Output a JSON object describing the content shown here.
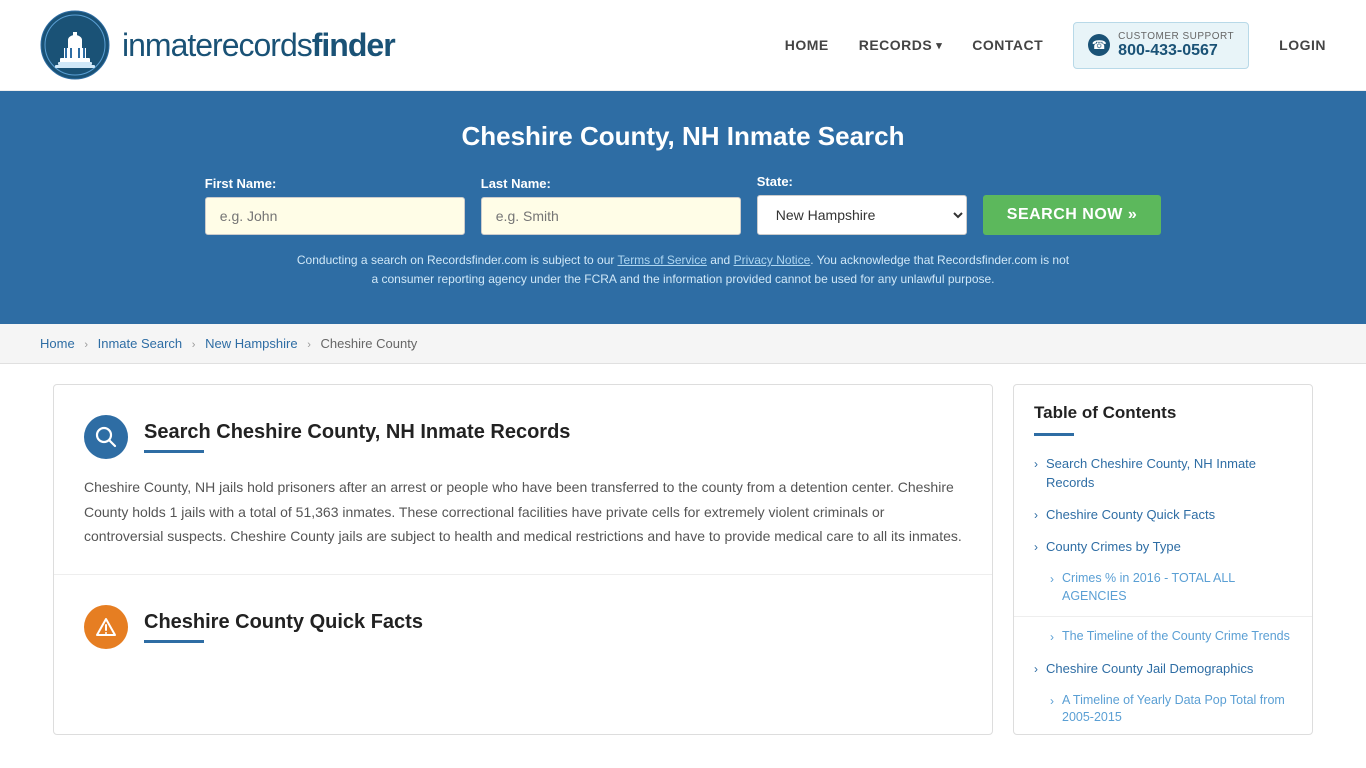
{
  "header": {
    "logo_text_normal": "inmaterecords",
    "logo_text_bold": "finder",
    "nav": {
      "home_label": "HOME",
      "records_label": "RECORDS",
      "contact_label": "CONTACT",
      "support_label": "CUSTOMER SUPPORT",
      "support_number": "800-433-0567",
      "login_label": "LOGIN"
    }
  },
  "search_section": {
    "title": "Cheshire County, NH Inmate Search",
    "first_name_label": "First Name:",
    "first_name_placeholder": "e.g. John",
    "last_name_label": "Last Name:",
    "last_name_placeholder": "e.g. Smith",
    "state_label": "State:",
    "state_value": "New Hampshire",
    "search_button_label": "SEARCH NOW »",
    "disclaimer": "Conducting a search on Recordsfinder.com is subject to our Terms of Service and Privacy Notice. You acknowledge that Recordsfinder.com is not a consumer reporting agency under the FCRA and the information provided cannot be used for any unlawful purpose.",
    "tos_label": "Terms of Service",
    "privacy_label": "Privacy Notice"
  },
  "breadcrumb": {
    "home": "Home",
    "inmate_search": "Inmate Search",
    "new_hampshire": "New Hampshire",
    "cheshire_county": "Cheshire County"
  },
  "main_section": {
    "title": "Search Cheshire County, NH Inmate Records",
    "body": "Cheshire County, NH jails hold prisoners after an arrest or people who have been transferred to the county from a detention center. Cheshire County holds 1 jails with a total of 51,363 inmates. These correctional facilities have private cells for extremely violent criminals or controversial suspects. Cheshire County jails are subject to health and medical restrictions and have to provide medical care to all its inmates."
  },
  "quick_facts_section": {
    "title": "Cheshire County Quick Facts"
  },
  "toc": {
    "title": "Table of Contents",
    "items": [
      {
        "label": "Search Cheshire County, NH Inmate Records",
        "sub": false
      },
      {
        "label": "Cheshire County Quick Facts",
        "sub": false
      },
      {
        "label": "County Crimes by Type",
        "sub": false
      },
      {
        "label": "Crimes % in 2016 - TOTAL ALL AGENCIES",
        "sub": true
      },
      {
        "label": "The Timeline of the County Crime Trends",
        "sub": true
      },
      {
        "label": "Cheshire County Jail Demographics",
        "sub": false
      },
      {
        "label": "A Timeline of Yearly Data Pop Total from 2005-2015",
        "sub": true
      }
    ]
  },
  "colors": {
    "primary": "#2e6da4",
    "green": "#5cb85c",
    "hero_bg": "#2e6da4"
  }
}
